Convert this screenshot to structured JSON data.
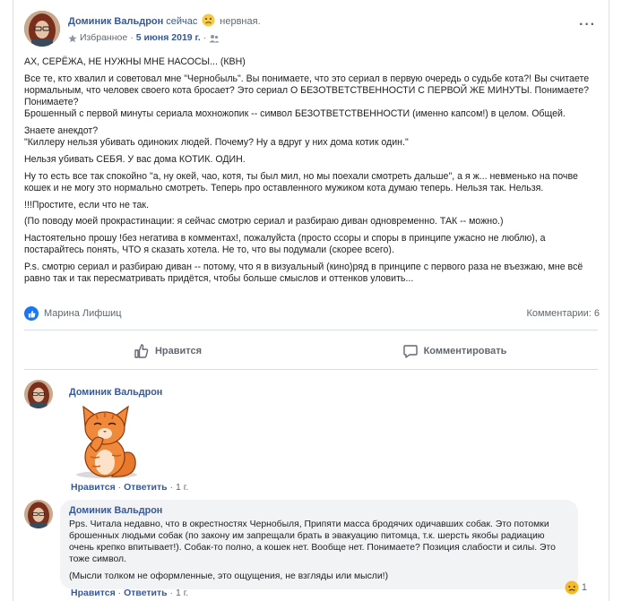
{
  "post": {
    "author": "Доминик Вальдрон",
    "time": "сейчас",
    "feeling": "нервная.",
    "audience": "Избранное",
    "date": "5 июня 2019 г.",
    "paragraphs": [
      "АХ, СЕРЁЖА, НЕ НУЖНЫ МНЕ НАСОСЫ... (КВН)",
      "Все те, кто хвалил и советовал мне \"Чернобыль\". Вы понимаете, что это сериал в первую очередь о судьбе кота?! Вы считаете нормальным, что человек своего кота бросает? Это сериал О БЕЗОТВЕТСТВЕННОСТИ С ПЕРВОЙ ЖЕ МИНУТЫ. Понимаете? Понимаете?\nБрошенный с первой минуты сериала мохножопик -- символ БЕЗОТВЕТСТВЕННОСТИ (именно капсом!) в целом. Общей.",
      "Знаете анекдот?\n\"Киллеру нельзя убивать одиноких людей. Почему? Ну а вдруг у них дома котик один.\"",
      "Нельзя убивать СЕБЯ. У вас дома КОТИК. ОДИН.",
      "Ну то есть все так спокойно \"а, ну окей, чао, котя, ты был мил, но мы поехали смотреть дальше\", а я ж... невменько на почве кошек и не могу это нормально смотреть. Теперь про оставленного мужиком кота думаю теперь. Нельзя так. Нельзя.",
      "!!!Простите, если что не так.",
      "(По поводу моей прокрастинации: я сейчас смотрю сериал и разбираю диван одновременно. ТАК -- можно.)",
      "Настоятельно прошу !без негатива в комментах!, пожалуйста (просто ссоры  и споры в принципе ужасно не люблю), а постарайтесь понять, ЧТО я сказать хотела. Не то, что вы подумали (скорее всего).",
      "P.s. смотрю сериал и разбираю диван -- потому, что я в визуальный (кино)ряд в принципе с первого раза не въезжаю, мне всё равно так и так пересматривать придётся, чтобы больше смыслов и оттенков уловить..."
    ],
    "reactor": "Марина Лифшиц",
    "comments_count": "Комментарии: 6"
  },
  "actions": {
    "like": "Нравится",
    "comment": "Комментировать"
  },
  "comments": [
    {
      "author": "Доминик Вальдрон",
      "like": "Нравится",
      "reply": "Ответить",
      "age": "1 г."
    },
    {
      "author": "Доминик Вальдрон",
      "text1": "Pps. Читала недавно, что в окрестностях Чернобыля, Припяти масса бродячих одичавших собак. Это потомки брошенных людьми собак (по закону им запрещали брать в эвакуацию питомца, т.к. шерсть якобы радиацию очень крепко впитывает!). Собак-то полно, а кошек нет. Вообще нет. Понимаете? Позиция слабости и силы. Это тоже символ.",
      "text2": "(Мысли толком не оформленные, это ощущения, не взгляды или мысли!)",
      "like": "Нравится",
      "reply": "Ответить",
      "age": "1 г.",
      "reaction_count": "1"
    }
  ],
  "colors": {
    "link": "#365899",
    "like_blue": "#1877f2",
    "bubble": "#f2f3f5",
    "cat_orange": "#e8782a"
  },
  "icons": [
    "sad-face-emoji",
    "people-icon",
    "more-dots-icon",
    "like-thumb-icon",
    "comment-bubble-icon",
    "sad-reaction-icon",
    "cat-sticker"
  ]
}
